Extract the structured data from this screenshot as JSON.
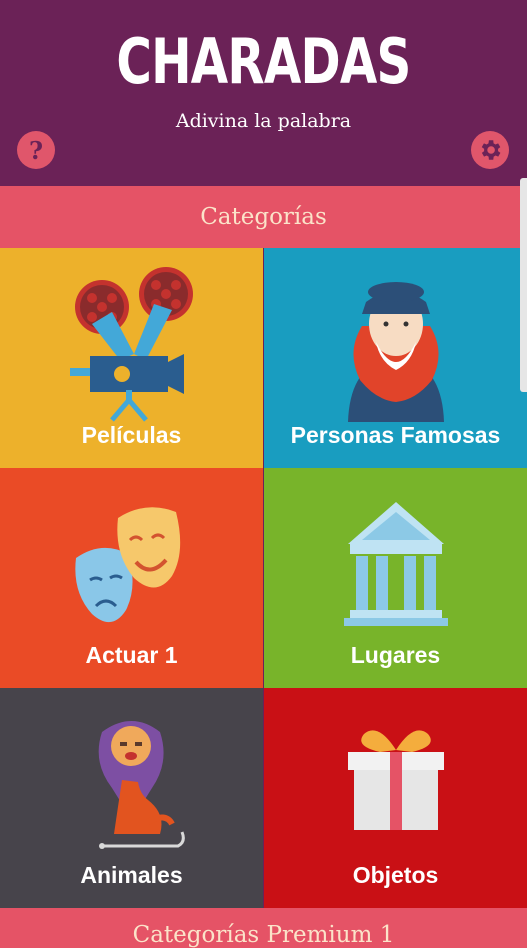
{
  "header": {
    "title": "CHARADAS",
    "subtitle": "Adivina la palabra",
    "help_icon": "question-icon",
    "settings_icon": "gear-icon"
  },
  "categories_label": "Categorías",
  "premium_label": "Categorías Premium 1",
  "tiles": [
    {
      "label": "Películas",
      "color": "#edb12b",
      "icon": "film-camera-icon"
    },
    {
      "label": "Personas Famosas",
      "color": "#199dc0",
      "icon": "famous-person-icon"
    },
    {
      "label": "Actuar 1",
      "color": "#ea4b26",
      "icon": "theater-masks-icon"
    },
    {
      "label": "Lugares",
      "color": "#78b42a",
      "icon": "temple-icon"
    },
    {
      "label": "Animales",
      "color": "#47444b",
      "icon": "lion-icon"
    },
    {
      "label": "Objetos",
      "color": "#c91015",
      "icon": "gift-icon"
    }
  ],
  "colors": {
    "header_bg": "#6b2257",
    "section_bar": "#e55366",
    "section_text": "#fbe3c9"
  }
}
